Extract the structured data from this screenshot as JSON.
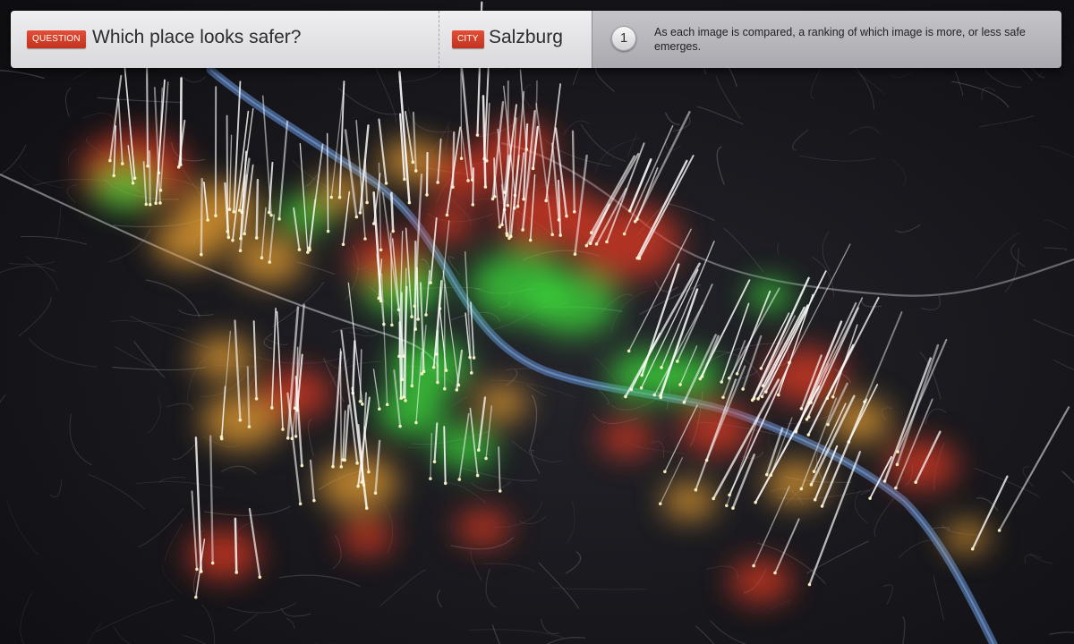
{
  "question": {
    "tag": "QUESTION",
    "text": "Which place looks safer?"
  },
  "city": {
    "tag": "CITY",
    "name": "Salzburg"
  },
  "info": {
    "step": "1",
    "text": "As each image is compared, a ranking of which image is more, or less safe emerges."
  },
  "map": {
    "icon": "city-safety-map",
    "colors": {
      "background": "#17171c",
      "river": "#4a6a9a",
      "safe": "#3fdc3a",
      "neutral": "#e8a030",
      "unsafe": "#e23a24"
    }
  }
}
